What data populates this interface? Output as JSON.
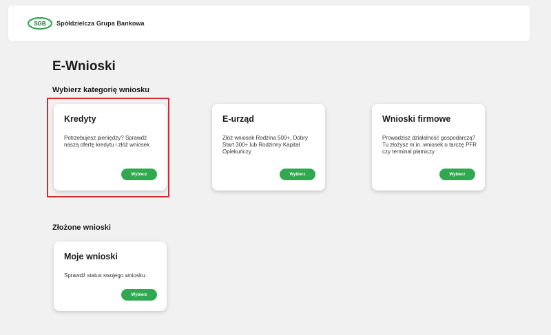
{
  "header": {
    "logo_mark": "SGB",
    "bank_name": "Spółdzielcza Grupa Bankowa"
  },
  "page": {
    "title": "E-Wnioski"
  },
  "categories": {
    "title": "Wybierz kategorię wniosku",
    "cards": [
      {
        "title": "Kredyty",
        "description": "Potrzebujesz pieniędzy? Sprawdź naszą ofertę kredytu i złóż wniosek",
        "button": "Wybierz"
      },
      {
        "title": "E-urząd",
        "description": "Złóż wniosek Rodzina 500+, Dobry Start 300+ lub Rodzinny Kapitał Opiekuńczy",
        "button": "Wybierz"
      },
      {
        "title": "Wnioski firmowe",
        "description": "Prowadzisz działalność gospodarczą? Tu złożysz m.in. wniosek o tarczę PFR czy terminal płatniczy.",
        "button": "Wybierz"
      }
    ]
  },
  "submitted": {
    "title": "Złożone wnioski",
    "cards": [
      {
        "title": "Moje wnioski",
        "description": "Sprawdź status swojego wniosku.",
        "button": "Wybierz"
      }
    ]
  },
  "colors": {
    "accent_green": "#2fa84f",
    "highlight_red": "#d9272e"
  }
}
